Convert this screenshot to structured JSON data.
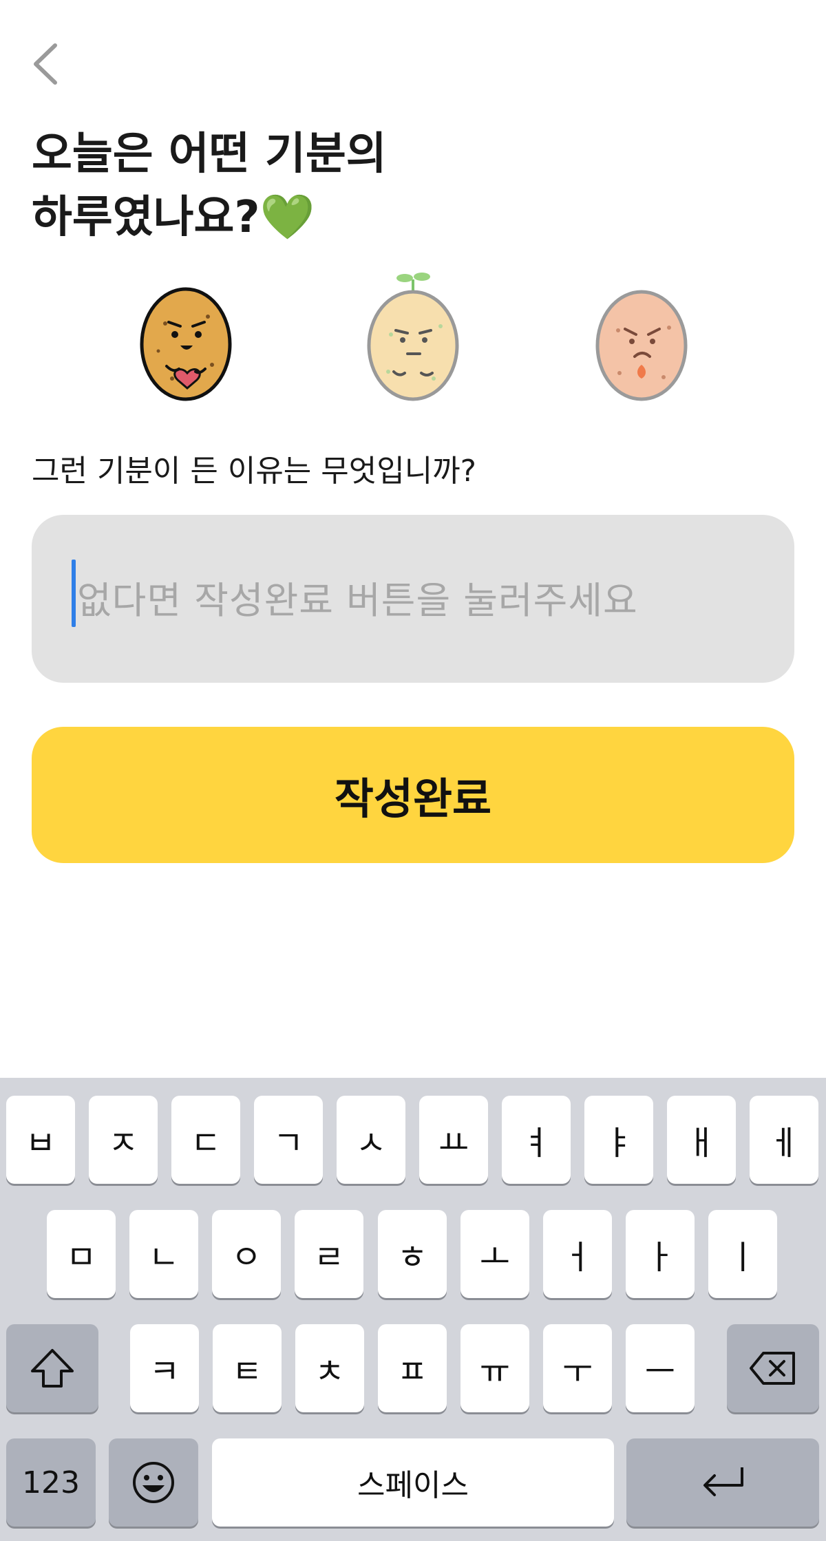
{
  "header": {
    "back_icon": "chevron-left-icon"
  },
  "title": {
    "line1": "오늘은 어떤 기분의",
    "line2": "하루였나요?",
    "heart": "💚",
    "heart_color": "#3cc24a"
  },
  "moods": [
    {
      "name": "happy",
      "color": "#e2a84c"
    },
    {
      "name": "neutral",
      "color": "#f7dfae"
    },
    {
      "name": "angry",
      "color": "#f4c3a7"
    }
  ],
  "question": "그런 기분이 든 이유는 무엇입니까?",
  "reason_input": {
    "value": "",
    "placeholder": "없다면 작성완료 버튼을 눌러주세요"
  },
  "submit_button": {
    "label": "작성완료",
    "color": "#ffd53f"
  },
  "keyboard": {
    "row1": [
      "ㅂ",
      "ㅈ",
      "ㄷ",
      "ㄱ",
      "ㅅ",
      "ㅛ",
      "ㅕ",
      "ㅑ",
      "ㅐ",
      "ㅔ"
    ],
    "row2": [
      "ㅁ",
      "ㄴ",
      "ㅇ",
      "ㄹ",
      "ㅎ",
      "ㅗ",
      "ㅓ",
      "ㅏ",
      "ㅣ"
    ],
    "row3": [
      "ㅋ",
      "ㅌ",
      "ㅊ",
      "ㅍ",
      "ㅠ",
      "ㅜ",
      "ㅡ"
    ],
    "numbers_label": "123",
    "space_label": "스페이스",
    "shift_icon": "shift-icon",
    "delete_icon": "backspace-icon",
    "emoji_icon": "emoji-icon",
    "return_icon": "return-icon"
  }
}
